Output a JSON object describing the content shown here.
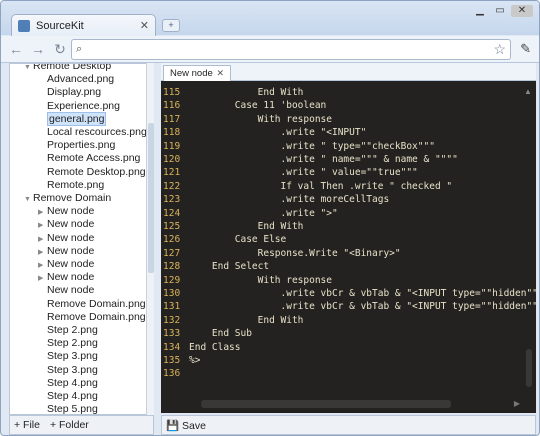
{
  "window": {
    "tab_title": "SourceKit",
    "tab_close": "✕",
    "new_tab": "+"
  },
  "toolbar": {
    "back": "←",
    "forward": "→",
    "reload": "↻",
    "search_glyph": "🔍",
    "star": "☆",
    "wrench": "🔧",
    "omnibox_value": ""
  },
  "tree": [
    {
      "label": "Remote Desktop",
      "indent": 1,
      "arrow": "▼"
    },
    {
      "label": "Advanced.png",
      "indent": 2
    },
    {
      "label": "Display.png",
      "indent": 2
    },
    {
      "label": "Experience.png",
      "indent": 2
    },
    {
      "label": "general.png",
      "indent": 2,
      "selected": true
    },
    {
      "label": "Local rescources.png",
      "indent": 2
    },
    {
      "label": "Properties.png",
      "indent": 2
    },
    {
      "label": "Remote Access.png",
      "indent": 2
    },
    {
      "label": "Remote Desktop.png",
      "indent": 2
    },
    {
      "label": "Remote.png",
      "indent": 2
    },
    {
      "label": "Remove Domain",
      "indent": 1,
      "arrow": "▼"
    },
    {
      "label": "New node",
      "indent": 2,
      "arrow": "▶"
    },
    {
      "label": "New node",
      "indent": 2,
      "arrow": "▶"
    },
    {
      "label": "New node",
      "indent": 2,
      "arrow": "▶"
    },
    {
      "label": "New node",
      "indent": 2,
      "arrow": "▶"
    },
    {
      "label": "New node",
      "indent": 2,
      "arrow": "▶"
    },
    {
      "label": "New node",
      "indent": 2,
      "arrow": "▶"
    },
    {
      "label": "New node",
      "indent": 2
    },
    {
      "label": "Remove Domain.png",
      "indent": 2
    },
    {
      "label": "Remove Domain.png",
      "indent": 2
    },
    {
      "label": "Step 2.png",
      "indent": 2
    },
    {
      "label": "Step 2.png",
      "indent": 2
    },
    {
      "label": "Step 3.png",
      "indent": 2
    },
    {
      "label": "Step 3.png",
      "indent": 2
    },
    {
      "label": "Step 4.png",
      "indent": 2
    },
    {
      "label": "Step 4.png",
      "indent": 2
    },
    {
      "label": "Step 5.png",
      "indent": 2
    }
  ],
  "left_actions": {
    "add_file": "+ File",
    "add_folder": "+ Folder"
  },
  "editor": {
    "tab_label": "New node",
    "tab_close": "✕",
    "save_label": "Save",
    "lines": [
      {
        "n": "115",
        "text": "            End With"
      },
      {
        "n": "116",
        "text": "        Case 11 'boolean"
      },
      {
        "n": "117",
        "text": "            With response"
      },
      {
        "n": "118",
        "text": "                .write \"<INPUT\""
      },
      {
        "n": "119",
        "text": "                .write \" type=\"\"checkBox\"\"\""
      },
      {
        "n": "120",
        "text": "                .write \" name=\"\"\" & name & \"\"\"\""
      },
      {
        "n": "121",
        "text": "                .write \" value=\"\"true\"\"\""
      },
      {
        "n": "122",
        "text": "                If val Then .write \" checked \""
      },
      {
        "n": "123",
        "text": "                .write moreCellTags"
      },
      {
        "n": "124",
        "text": "                .write \">\""
      },
      {
        "n": "125",
        "text": "            End With"
      },
      {
        "n": "126",
        "text": "        Case Else"
      },
      {
        "n": "127",
        "text": "            Response.Write \"<Binary>\""
      },
      {
        "n": "128",
        "text": "    End Select"
      },
      {
        "n": "129",
        "text": "            With response"
      },
      {
        "n": "130",
        "text": "                .write vbCr & vbTab & \"<INPUT type=\"\"hidden\"\" n"
      },
      {
        "n": "131",
        "text": "                .write vbCr & vbTab & \"<INPUT type=\"\"hidden\"\" n"
      },
      {
        "n": "132",
        "text": "            End With"
      },
      {
        "n": "133",
        "text": "    End Sub"
      },
      {
        "n": "134",
        "text": "End Class"
      },
      {
        "n": "135",
        "text": "%>"
      },
      {
        "n": "136",
        "text": ""
      }
    ]
  }
}
